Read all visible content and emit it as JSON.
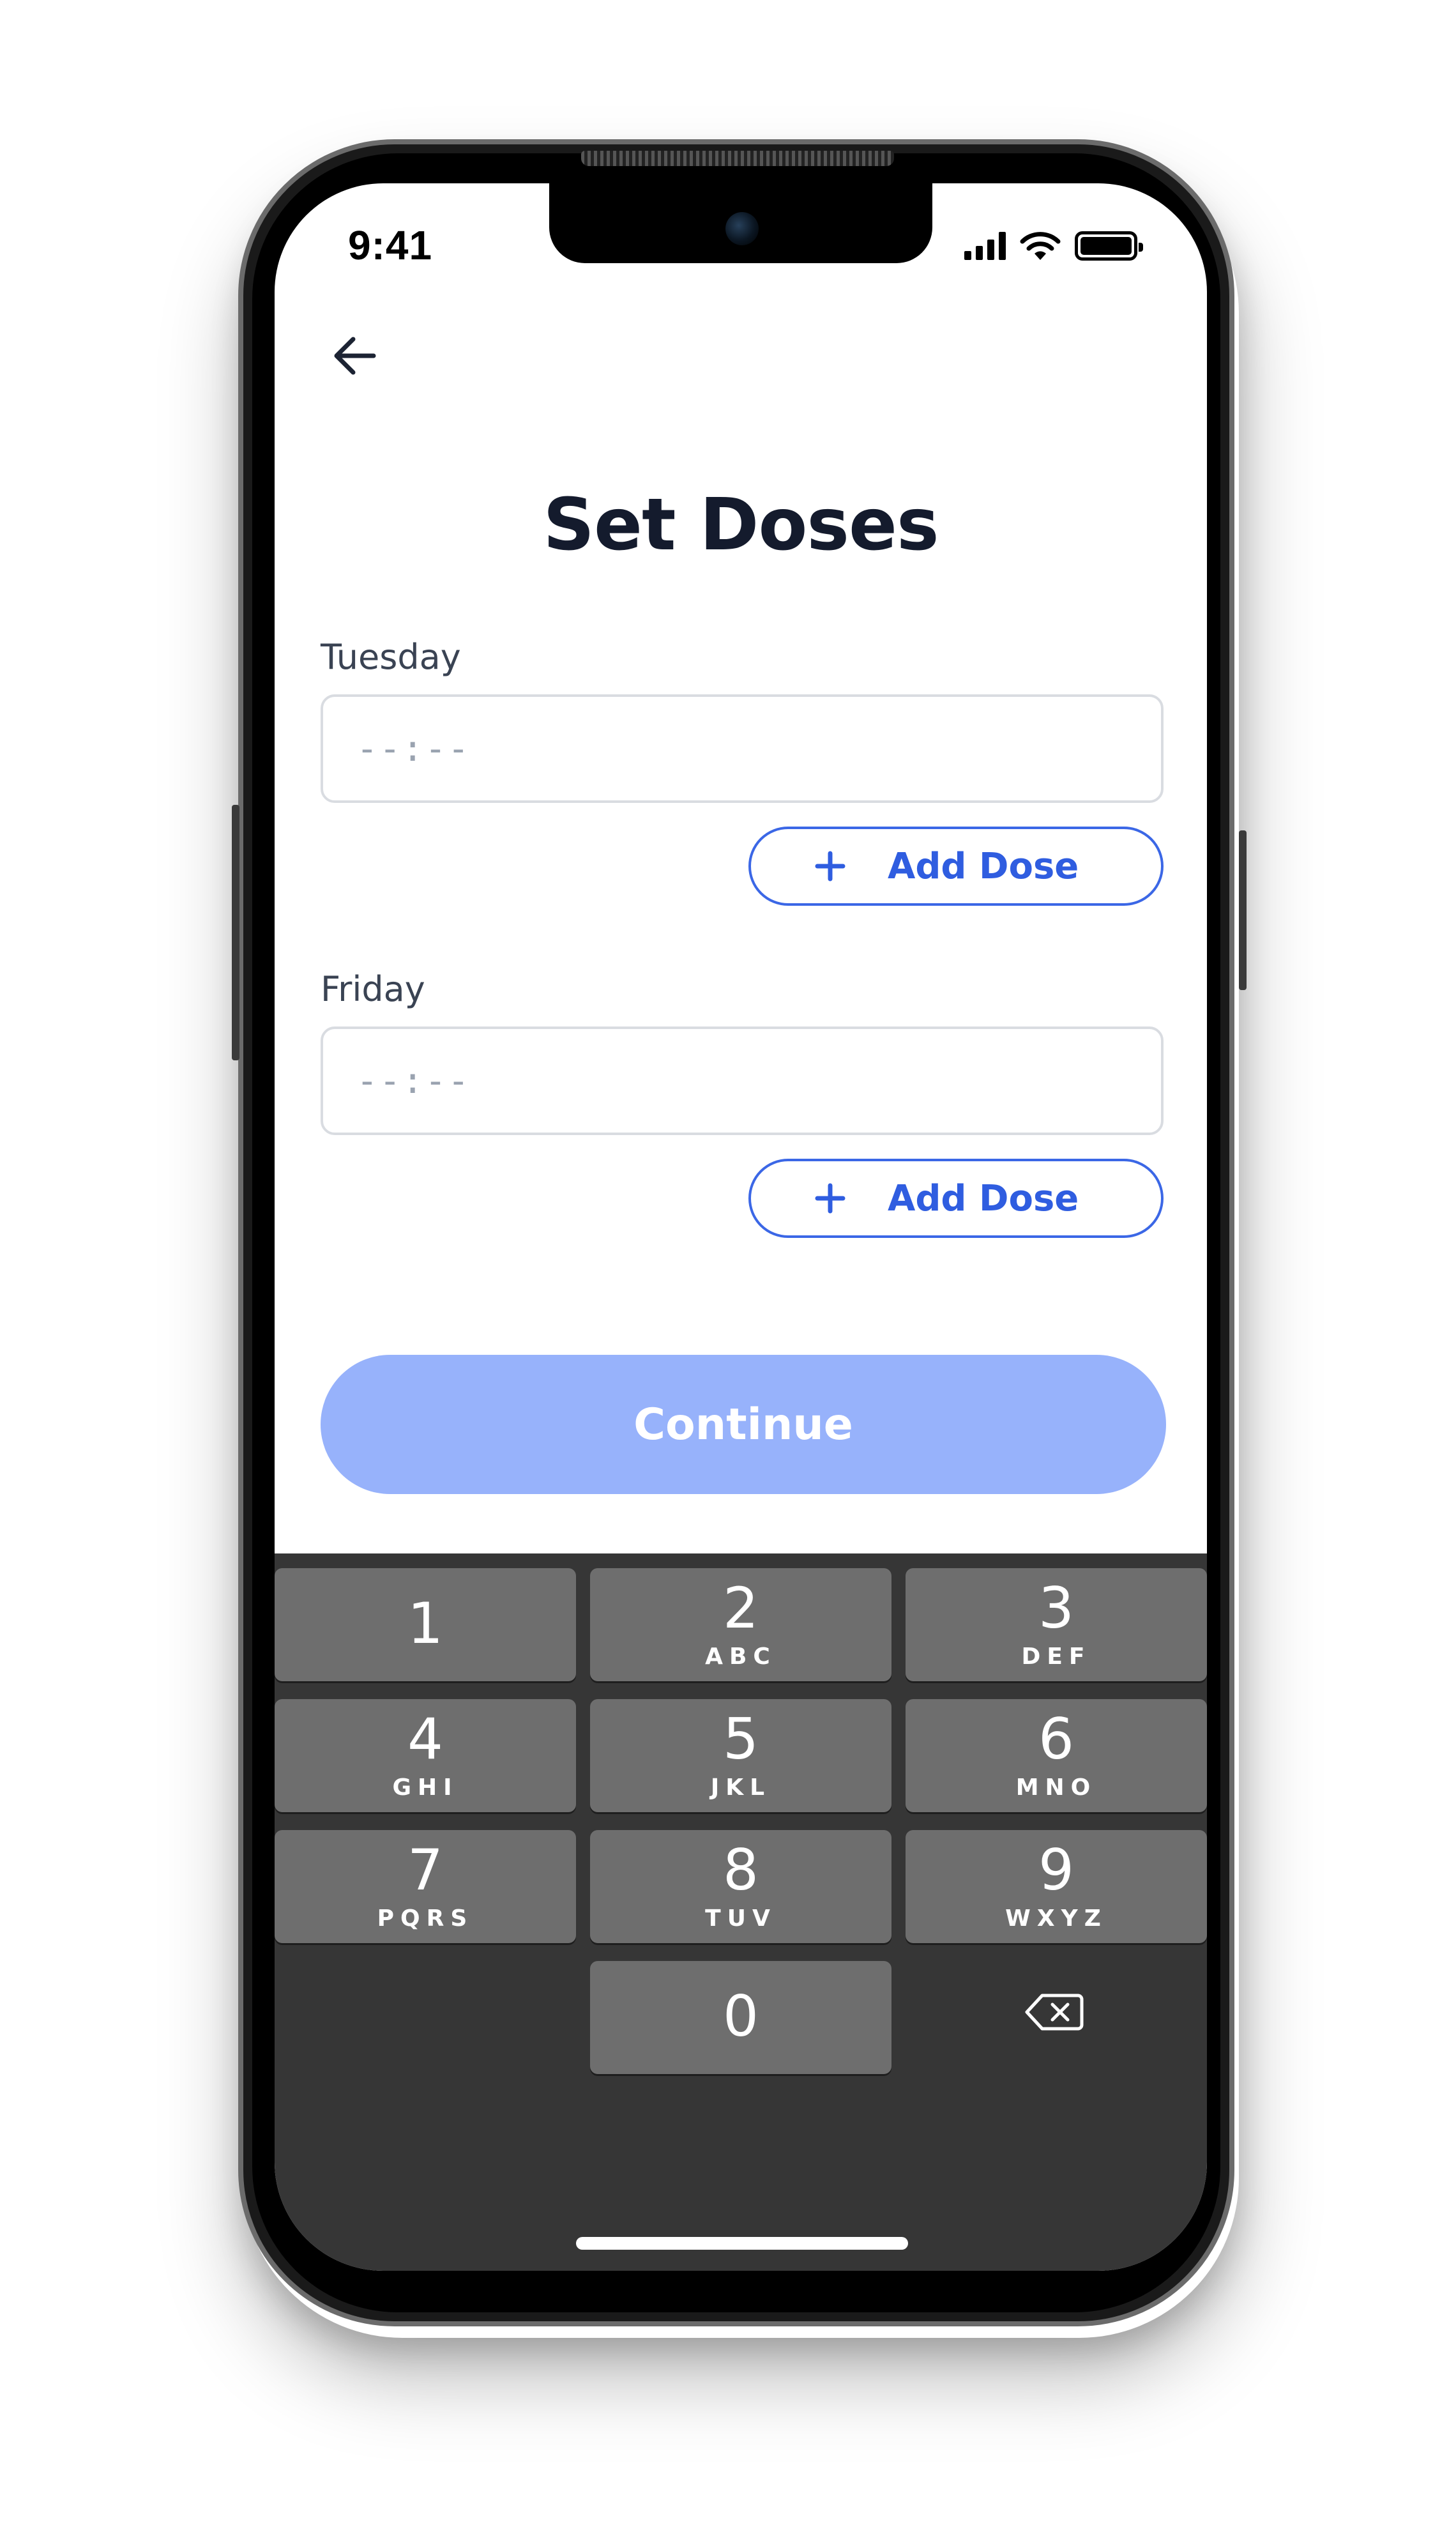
{
  "status_bar": {
    "time": "9:41"
  },
  "header": {
    "back_icon": "arrow-left-icon"
  },
  "page": {
    "title": "Set Doses"
  },
  "doses": [
    {
      "day": "Tuesday",
      "time_placeholder": "--:--",
      "add_label": "Add Dose"
    },
    {
      "day": "Friday",
      "time_placeholder": "--:--",
      "add_label": "Add Dose"
    }
  ],
  "continue_button": {
    "label": "Continue"
  },
  "colors": {
    "accent": "#2f5de0",
    "continue_disabled": "#97b2fb",
    "title": "#141b2d",
    "keypad_bg": "#363636",
    "key_bg": "#6e6e6e"
  },
  "keypad": {
    "keys": [
      {
        "digit": "1",
        "letters": ""
      },
      {
        "digit": "2",
        "letters": "ABC"
      },
      {
        "digit": "3",
        "letters": "DEF"
      },
      {
        "digit": "4",
        "letters": "GHI"
      },
      {
        "digit": "5",
        "letters": "JKL"
      },
      {
        "digit": "6",
        "letters": "MNO"
      },
      {
        "digit": "7",
        "letters": "PQRS"
      },
      {
        "digit": "8",
        "letters": "TUV"
      },
      {
        "digit": "9",
        "letters": "WXYZ"
      },
      {
        "digit": "0",
        "letters": ""
      }
    ],
    "delete_icon": "backspace-icon"
  }
}
